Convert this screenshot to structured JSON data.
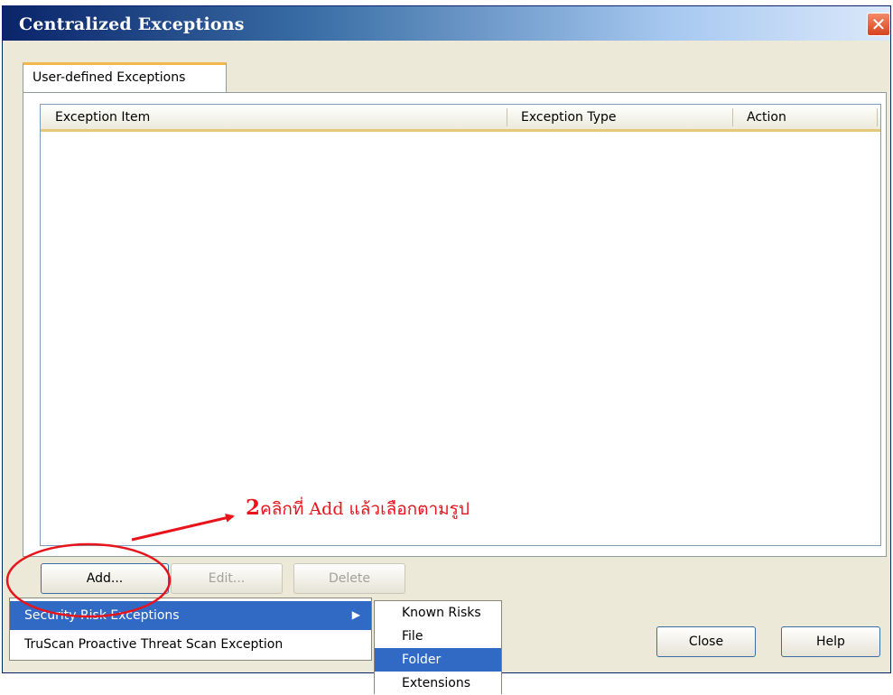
{
  "window": {
    "title": "Centralized Exceptions",
    "close_glyph": "✕"
  },
  "tabs": [
    {
      "label": "User-defined Exceptions"
    }
  ],
  "listview": {
    "columns": [
      "Exception Item",
      "Exception Type",
      "Action"
    ],
    "rows": []
  },
  "buttons": {
    "add": "Add...",
    "edit": "Edit...",
    "delete": "Delete",
    "close": "Close",
    "help": "Help"
  },
  "add_menu": {
    "items": [
      {
        "label": "Security Risk Exceptions",
        "has_submenu": true,
        "selected": true
      },
      {
        "label": "TruScan Proactive Threat Scan Exception",
        "has_submenu": false,
        "selected": false
      }
    ],
    "submenu_arrow": "▶"
  },
  "submenu": {
    "items": [
      {
        "label": "Known Risks",
        "selected": false
      },
      {
        "label": "File",
        "selected": false
      },
      {
        "label": "Folder",
        "selected": true
      },
      {
        "label": "Extensions",
        "selected": false
      }
    ]
  },
  "annotation": {
    "number": "2",
    "text": "คลิกที่ Add แล้วเลือกตามรูป",
    "color": "#e8141c"
  },
  "colors": {
    "title_bar": "#0a246a",
    "selection": "#316ac5",
    "tab_accent": "#f1b74b"
  }
}
